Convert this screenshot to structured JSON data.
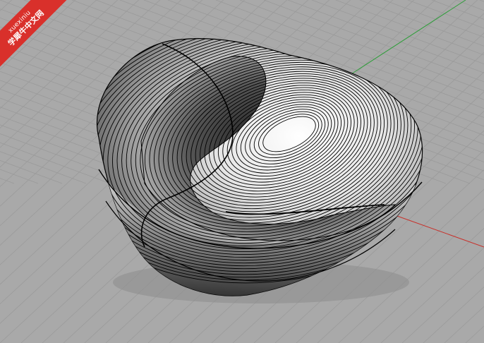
{
  "viewport": {
    "background_color": "#a9a9a9",
    "grid_color": "#9a9a9a",
    "axis_x_color": "#c8302a",
    "axis_y_color": "#2f9e3a",
    "object": "surface-model-with-isocurves"
  },
  "watermark": {
    "text_en": "xuexiniu",
    "text_cn": "学犀牛中文网",
    "color": "#d9302b"
  }
}
